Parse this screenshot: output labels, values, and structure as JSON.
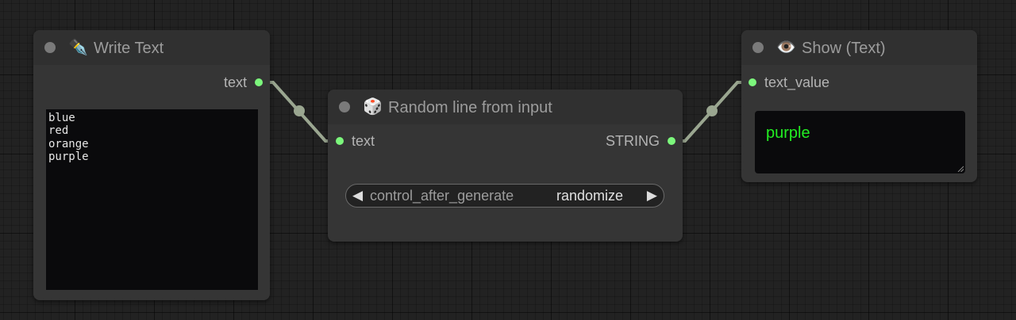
{
  "nodes": {
    "write_text": {
      "icon": "✒️",
      "icon_name": "pen-nib-icon",
      "title": "Write Text",
      "output_label": "text",
      "text": "blue\nred\norange\npurple"
    },
    "random_line": {
      "icon": "🎲",
      "icon_name": "dice-icon",
      "title": "Random line from input",
      "input_label": "text",
      "output_label": "STRING",
      "widget": {
        "name": "control_after_generate",
        "value": "randomize",
        "left_arrow": "◀",
        "right_arrow": "▶"
      }
    },
    "show_text": {
      "icon": "👁️",
      "icon_name": "eye-icon",
      "title": "Show (Text)",
      "input_label": "text_value",
      "value": "purple"
    }
  },
  "colors": {
    "canvas_bg": "#222222",
    "node_bg": "#353535",
    "node_header_bg": "#303030",
    "slot_string": "#7cf77c",
    "link": "#9aa690",
    "show_value_text": "#22ee22"
  }
}
